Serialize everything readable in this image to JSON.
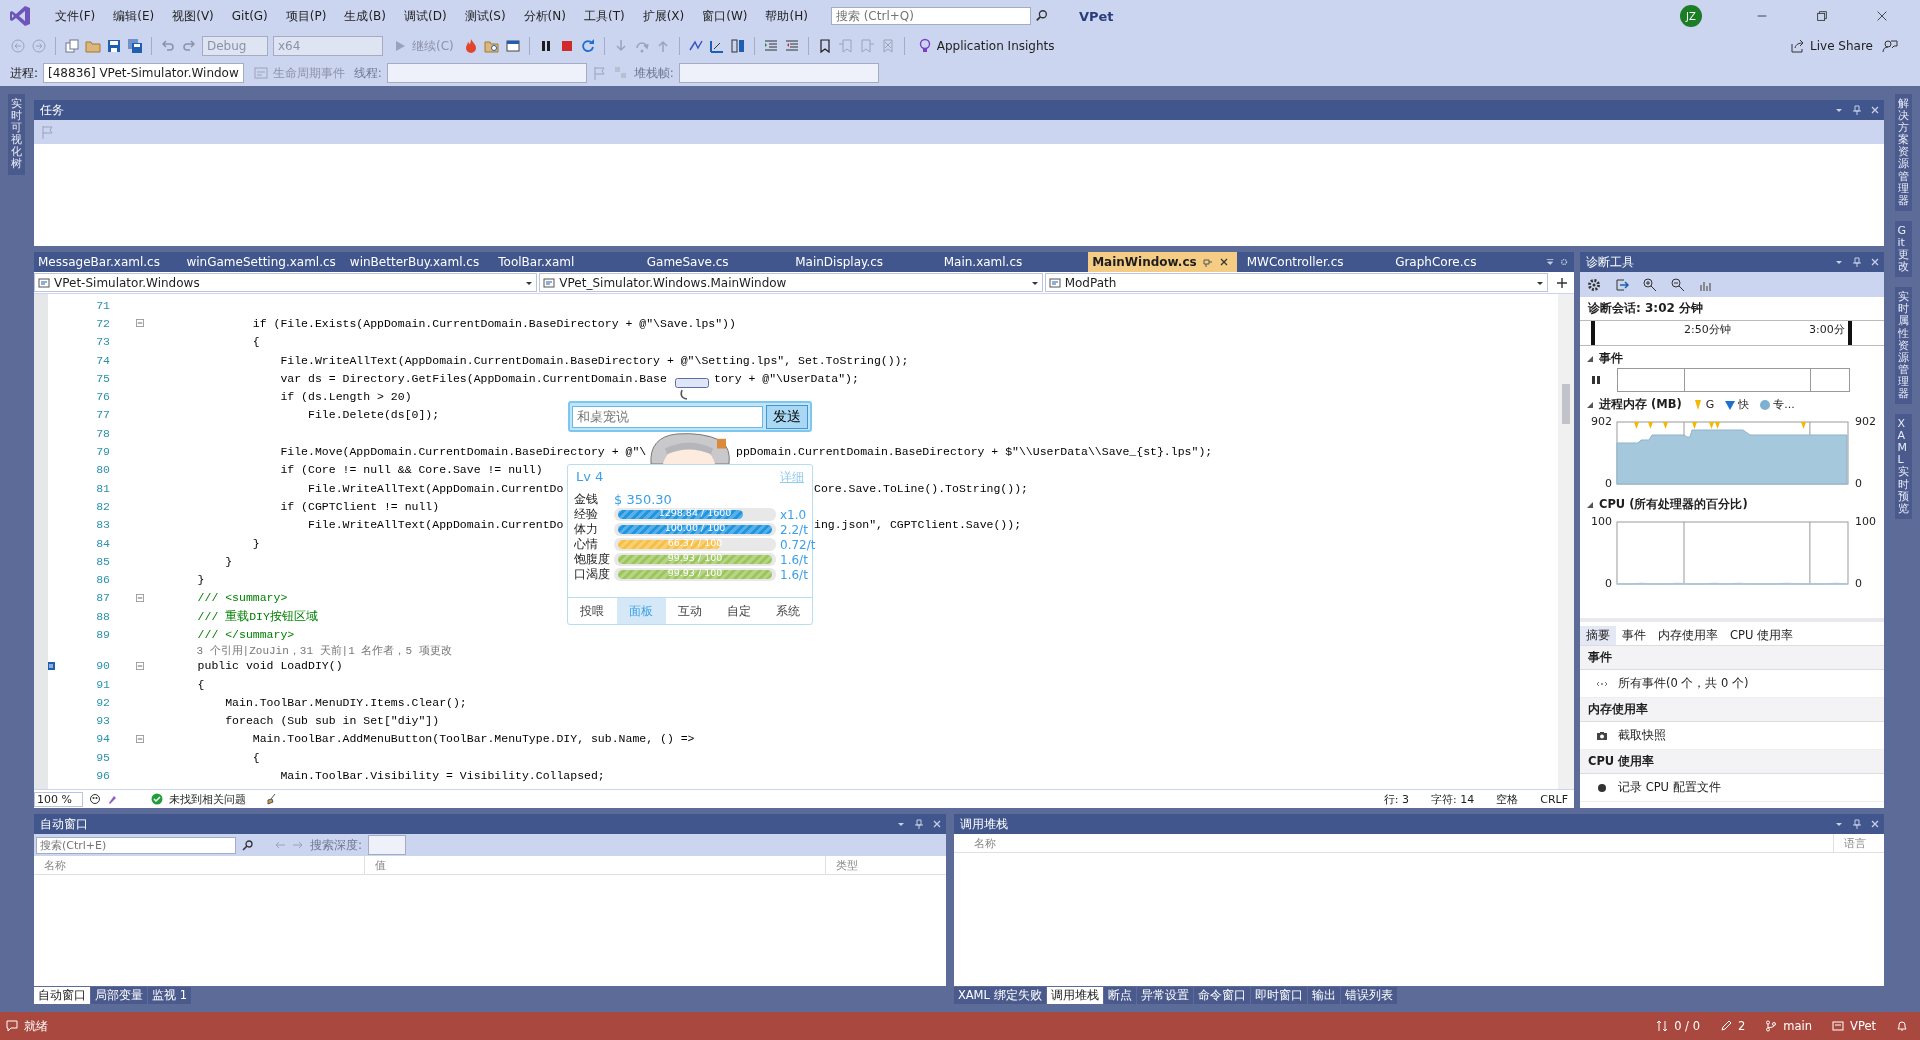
{
  "menu": [
    "文件(F)",
    "编辑(E)",
    "视图(V)",
    "Git(G)",
    "项目(P)",
    "生成(B)",
    "调试(D)",
    "测试(S)",
    "分析(N)",
    "工具(T)",
    "扩展(X)",
    "窗口(W)",
    "帮助(H)"
  ],
  "search": {
    "placeholder": "搜索 (Ctrl+Q)"
  },
  "solution_name": "VPet",
  "user_initials": "JZ",
  "toolbar": {
    "config": "Debug",
    "platform": "x64",
    "continue": "继续(C)",
    "insights": "Application Insights",
    "live_share": "Live Share"
  },
  "debug_bar": {
    "process_label": "进程:",
    "process": "[48836] VPet-Simulator.Window",
    "lifecycle": "生命周期事件",
    "thread_label": "线程:",
    "stack_label": "堆栈帧:"
  },
  "left_strip": [
    "实时可视化树"
  ],
  "right_strip": [
    "解决方案资源管理器",
    "Git 更改",
    "实时属性资源管理器",
    "XAML 实时预览"
  ],
  "tasks_panel": {
    "title": "任务"
  },
  "editor": {
    "tabs": [
      {
        "label": "MessageBar.xaml.cs",
        "selected": false
      },
      {
        "label": "winGameSetting.xaml.cs",
        "selected": false
      },
      {
        "label": "winBetterBuy.xaml.cs",
        "selected": false
      },
      {
        "label": "ToolBar.xaml",
        "selected": false
      },
      {
        "label": "GameSave.cs",
        "selected": false
      },
      {
        "label": "MainDisplay.cs",
        "selected": false
      },
      {
        "label": "Main.xaml.cs",
        "selected": false
      },
      {
        "label": "MainWindow.cs",
        "selected": true
      },
      {
        "label": "MWController.cs",
        "selected": false
      },
      {
        "label": "GraphCore.cs",
        "selected": false
      }
    ],
    "nav": [
      "VPet-Simulator.Windows",
      "VPet_Simulator.Windows.MainWindow",
      "ModPath"
    ],
    "lines": [
      {
        "num": "71",
        "kind": "code"
      },
      {
        "num": "72",
        "kind": "code",
        "fold": true,
        "text": "            if (File.Exists(AppDomain.CurrentDomain.BaseDirectory + @\"\\Save.lps\"))"
      },
      {
        "num": "73",
        "kind": "code",
        "text": "            {"
      },
      {
        "num": "74",
        "kind": "code",
        "text": "                File.WriteAllText(AppDomain.CurrentDomain.BaseDirectory + @\"\\Setting.lps\", Set.ToString());"
      },
      {
        "num": "75",
        "kind": "code",
        "text": "                var ds = Directory.GetFiles(AppDomain.CurrentDomain.Base",
        "tail": {
          "text": "tory + @\"\\UserData\");"
        }
      },
      {
        "num": "76",
        "kind": "code",
        "text": "                if (ds.Length > 20)"
      },
      {
        "num": "77",
        "kind": "code",
        "text": "                    File.Delete(ds[0]);"
      },
      {
        "num": "78",
        "kind": "code"
      },
      {
        "num": "79",
        "kind": "code",
        "text": "                File.Move(AppDomain.CurrentDomain.BaseDirectory + @\"\\",
        "tail": {
          "text": "ppDomain.CurrentDomain.BaseDirectory + $\"\\\\UserData\\\\Save_{st}.lps\");"
        }
      },
      {
        "num": "80",
        "kind": "code",
        "text": "                if (Core != null && Core.Save != null)"
      },
      {
        "num": "81",
        "kind": "code",
        "text": "                    File.WriteAllText(AppDomain.CurrentDo",
        "tail": {
          "text": "Core.Save.ToLine().ToString());"
        }
      },
      {
        "num": "82",
        "kind": "code",
        "text": "                if (CGPTClient != null)"
      },
      {
        "num": "83",
        "kind": "code",
        "text": "                    File.WriteAllText(AppDomain.CurrentDo",
        "tail": {
          "text": "ing.json\", CGPTClient.Save());"
        }
      },
      {
        "num": "84",
        "kind": "code",
        "text": "            }"
      },
      {
        "num": "85",
        "kind": "code",
        "text": "        }"
      },
      {
        "num": "86",
        "kind": "code",
        "text": "    }"
      },
      {
        "num": "87",
        "kind": "comment",
        "fold": true,
        "text": "    /// <summary>"
      },
      {
        "num": "88",
        "kind": "comment",
        "text": "    /// 重载DIY按钮区域"
      },
      {
        "num": "89",
        "kind": "comment",
        "text": "    /// </summary>"
      },
      {
        "kind": "lens",
        "text": "    3 个引用|ZouJin，31 天前|1 名作者，5 项更改"
      },
      {
        "num": "90",
        "kind": "code",
        "fold": true,
        "glyph": true,
        "text": "    public void LoadDIY()"
      },
      {
        "num": "91",
        "kind": "code",
        "text": "    {"
      },
      {
        "num": "92",
        "kind": "code",
        "text": "        Main.ToolBar.MenuDIY.Items.Clear();"
      },
      {
        "num": "93",
        "kind": "code",
        "text": "        foreach (Sub sub in Set[\"diy\"])"
      },
      {
        "num": "94",
        "kind": "code",
        "fold": true,
        "text": "            Main.ToolBar.AddMenuButton(ToolBar.MenuType.DIY, sub.Name, () =>"
      },
      {
        "num": "95",
        "kind": "code",
        "text": "            {"
      },
      {
        "num": "96",
        "kind": "code",
        "text": "                Main.ToolBar.Visibility = Visibility.Collapsed;"
      }
    ],
    "status": {
      "zoom": "100 %",
      "issues": "未找到相关问题",
      "line": "行: 3",
      "col": "字符: 14",
      "spacing": "空格",
      "eol": "CRLF"
    }
  },
  "pet": {
    "chat_placeholder": "和桌宠说",
    "send": "发送",
    "level": "Lv 4",
    "detail": "详细",
    "money_label": "金钱",
    "money": "$ 350.30",
    "stats": [
      {
        "label": "经验",
        "reading": "1298.84 / 1600",
        "level": 0.81,
        "rate": "x1.0",
        "color": "#2196e0"
      },
      {
        "label": "体力",
        "reading": "100.00 / 100",
        "level": 1.0,
        "rate": "2.2/t",
        "color": "#2196e0"
      },
      {
        "label": "心情",
        "reading": "66.37 / 100",
        "level": 0.66,
        "rate": "0.72/t",
        "color": "#f7bf45"
      },
      {
        "label": "饱腹度",
        "reading": "99.93 / 100",
        "level": 0.999,
        "rate": "1.6/t",
        "color": "#9cc65c"
      },
      {
        "label": "口渴度",
        "reading": "99.93 / 100",
        "level": 0.999,
        "rate": "1.6/t",
        "color": "#9cc65c"
      }
    ],
    "tabs": [
      {
        "label": "投喂",
        "selected": false
      },
      {
        "label": "面板",
        "selected": true
      },
      {
        "label": "互动",
        "selected": false
      },
      {
        "label": "自定",
        "selected": false
      },
      {
        "label": "系统",
        "selected": false
      }
    ]
  },
  "diag": {
    "title": "诊断工具",
    "session": "诊断会话: 3:02 分钟",
    "timeline": [
      "2:50分钟",
      "3:00分"
    ],
    "events_title": "事件",
    "legend": [
      {
        "label": "G",
        "kind": "gc"
      },
      {
        "label": "快",
        "kind": "snapshot"
      },
      {
        "label": "专...",
        "kind": "private"
      }
    ],
    "memory": {
      "title": "进程内存 (MB)",
      "left_ticks": [
        "902",
        "0"
      ],
      "right_ticks": [
        "902",
        "0"
      ]
    },
    "cpu": {
      "right_ticks": [
        "100",
        "0"
      ],
      "chart_data": {
        "type": "area",
        "title": "CPU (所有处理器的百分比)",
        "categories": [
          null,
          null,
          null,
          null,
          null,
          null,
          null,
          null,
          null,
          null,
          null,
          null,
          null,
          null,
          null,
          null,
          null,
          null,
          null,
          null
        ],
        "series": [
          {
            "color": "#a6c8dc",
            "values": [
              0,
              0,
              1,
              0,
              0,
              1,
              0,
              0,
              1,
              0,
              1,
              0,
              0,
              0,
              1,
              0,
              0,
              0,
              1,
              0
            ]
          }
        ],
        "ylim": [
          0,
          100
        ],
        "yticks": [
          100,
          0
        ]
      }
    },
    "tabs": [
      {
        "label": "摘要",
        "selected": true
      },
      {
        "label": "事件",
        "selected": false
      },
      {
        "label": "内存使用率",
        "selected": false
      },
      {
        "label": "CPU 使用率",
        "selected": false
      }
    ],
    "sections": [
      {
        "title": "事件",
        "item": "所有事件(0 个，共 0 个)",
        "kind": "events"
      },
      {
        "title": "内存使用率",
        "item": "截取快照",
        "kind": "snapshot"
      },
      {
        "title": "CPU 使用率",
        "item": "记录 CPU 配置文件",
        "kind": "record"
      }
    ]
  },
  "autos": {
    "title": "自动窗口",
    "search_placeholder": "搜索(Ctrl+E)",
    "depth_label": "搜索深度:",
    "columns": [
      "名称",
      "值",
      "类型"
    ],
    "tabs": [
      {
        "label": "自动窗口",
        "selected": true
      },
      {
        "label": "局部变量",
        "selected": false
      },
      {
        "label": "监视 1",
        "selected": false
      }
    ]
  },
  "callstack": {
    "title": "调用堆栈",
    "columns": [
      "名称",
      "语言"
    ],
    "tabs": [
      {
        "label": "XAML 绑定失败",
        "selected": false
      },
      {
        "label": "调用堆栈",
        "selected": true
      },
      {
        "label": "断点",
        "selected": false
      },
      {
        "label": "异常设置",
        "selected": false
      },
      {
        "label": "命令窗口",
        "selected": false
      },
      {
        "label": "即时窗口",
        "selected": false
      },
      {
        "label": "输出",
        "selected": false
      },
      {
        "label": "错误列表",
        "selected": false
      }
    ]
  },
  "status": {
    "ready": "就绪",
    "changes": "0 / 0",
    "edits": "2",
    "branch": "main",
    "repo": "VPet"
  }
}
